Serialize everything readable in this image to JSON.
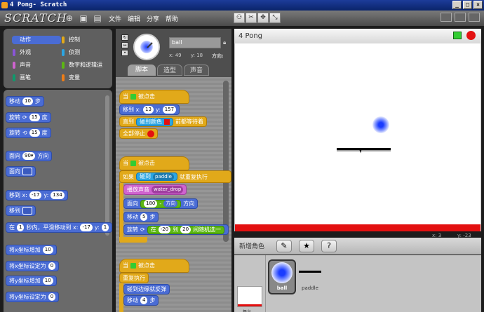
{
  "window": {
    "title": "4 Pong- Scratch"
  },
  "menu": {
    "logo": "SCRATCH",
    "items": [
      "文件",
      "编辑",
      "分享",
      "帮助"
    ]
  },
  "categories": [
    {
      "label": "动作",
      "color": "#4a6cd4"
    },
    {
      "label": "控制",
      "color": "#e1a91a"
    },
    {
      "label": "外观",
      "color": "#8a55d7"
    },
    {
      "label": "侦测",
      "color": "#2ca5e2"
    },
    {
      "label": "声音",
      "color": "#cf63cf"
    },
    {
      "label": "数字和逻辑运",
      "color": "#5cb712"
    },
    {
      "label": "画笔",
      "color": "#0e9a6c"
    },
    {
      "label": "变量",
      "color": "#ee7d16"
    }
  ],
  "palette": {
    "move": {
      "pre": "移动",
      "val": "10",
      "post": "步"
    },
    "turn_cw": {
      "pre": "旋转",
      "icon": "⟳",
      "val": "15",
      "post": "度"
    },
    "turn_ccw": {
      "pre": "旋转",
      "icon": "⟲",
      "val": "15",
      "post": "度"
    },
    "point_dir": {
      "pre": "面向",
      "val": "90▾",
      "post": "方向"
    },
    "point_to": {
      "pre": "面向"
    },
    "goto_xy": {
      "pre": "移到 x:",
      "x": "-17",
      "mid": "y:",
      "y": "134"
    },
    "goto": {
      "pre": "移到"
    },
    "glide": {
      "pre": "在",
      "secs": "1",
      "mid": "秒内，平滑移动到 x:",
      "x": "-17",
      "y_label": "y:",
      "y": "1"
    },
    "change_x": {
      "pre": "将x坐标增加",
      "val": "10"
    },
    "set_x": {
      "pre": "将x坐标设定为",
      "val": "0"
    },
    "change_y": {
      "pre": "将y坐标增加",
      "val": "10"
    },
    "set_y": {
      "pre": "将y坐标设定为",
      "val": "0"
    }
  },
  "sprite": {
    "name": "ball",
    "x_label": "x: 49",
    "y_label": "y: 18",
    "dir_label": "方向:"
  },
  "tabs": [
    "脚本",
    "造型",
    "声音"
  ],
  "scripts": {
    "s1": {
      "hat": {
        "pre": "当",
        "post": "被点击"
      },
      "goto": {
        "pre": "移到 x:",
        "x": "13",
        "mid": "y:",
        "y": "157"
      },
      "until": {
        "pre": "直到",
        "touch": "碰到颜色",
        "post": "前都等待着"
      },
      "stop": "全部停止"
    },
    "s2": {
      "hat": {
        "pre": "当",
        "post": "被点击"
      },
      "if": {
        "pre": "如果",
        "touch": "碰到",
        "target": "paddle",
        "post": "就重复执行"
      },
      "sound": {
        "pre": "播放声音",
        "val": "water_drop"
      },
      "point": {
        "pre": "面向",
        "val": "180",
        "op": "-",
        "dir": "方向",
        "post": "方向"
      },
      "move": {
        "pre": "移动",
        "val": "5",
        "post": "步"
      },
      "turn": {
        "pre": "旋转",
        "icon": "⟳",
        "in": "在",
        "a": "-20",
        "to": "到",
        "b": "20",
        "post": "间随机选一"
      }
    },
    "s3": {
      "hat": {
        "pre": "当",
        "post": "被点击"
      },
      "forever": "重复执行",
      "bounce": "碰到边缘就反弹",
      "move": {
        "pre": "移动",
        "val": "4",
        "post": "步"
      }
    }
  },
  "stage": {
    "title": "4 Pong",
    "coords_x": "x: 3",
    "coords_y": "y: -23"
  },
  "sprites_panel": {
    "new_sprite": "新增角色",
    "stage_label": "舞台",
    "sprites": [
      {
        "name": "ball"
      },
      {
        "name": "paddle"
      }
    ]
  },
  "colors": {
    "motion": "#4a6cd4",
    "control": "#e1a91a",
    "sensing": "#2ca5e2",
    "sound": "#cf63cf",
    "operators": "#5cb712",
    "stage_bottom": "#e31010"
  }
}
